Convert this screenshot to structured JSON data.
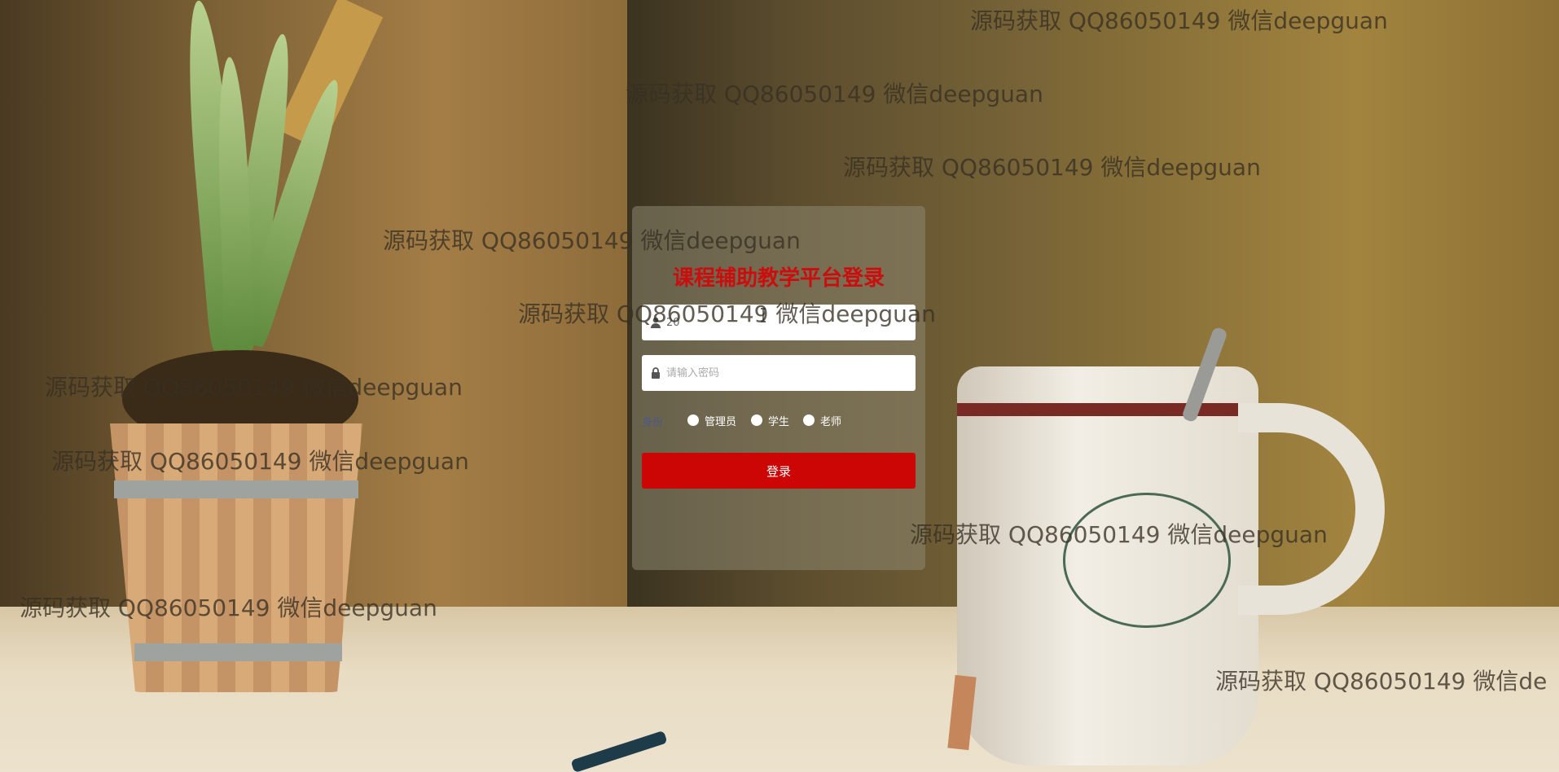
{
  "login": {
    "title": "课程辅助教学平台登录",
    "username": {
      "value": "20",
      "placeholder": ""
    },
    "password": {
      "value": "",
      "placeholder": "请输入密码"
    },
    "roles": {
      "label": "身份",
      "options": [
        "管理员",
        "学生",
        "老师"
      ]
    },
    "submit_label": "登录"
  },
  "watermarks": [
    "源码获取 QQ86050149 微信deepguan",
    "源码获取 QQ86050149 微信deepguan",
    "源码获取 QQ86050149 微信deepguan",
    "源码获取 QQ86050149 微信deepguan",
    "源码获取 QQ86050149 微信deepguan",
    "源码获取 QQ86050149 微信deepguan",
    "源码获取 QQ86050149 微信deepguan",
    "源码获取 QQ86050149 微信deepguan",
    "源码获取 QQ86050149 微信deepguan",
    "源码获取 QQ86050149 微信de"
  ],
  "colors": {
    "title": "#cc0d0d",
    "button": "#cc0505",
    "card": "#8c8770"
  }
}
